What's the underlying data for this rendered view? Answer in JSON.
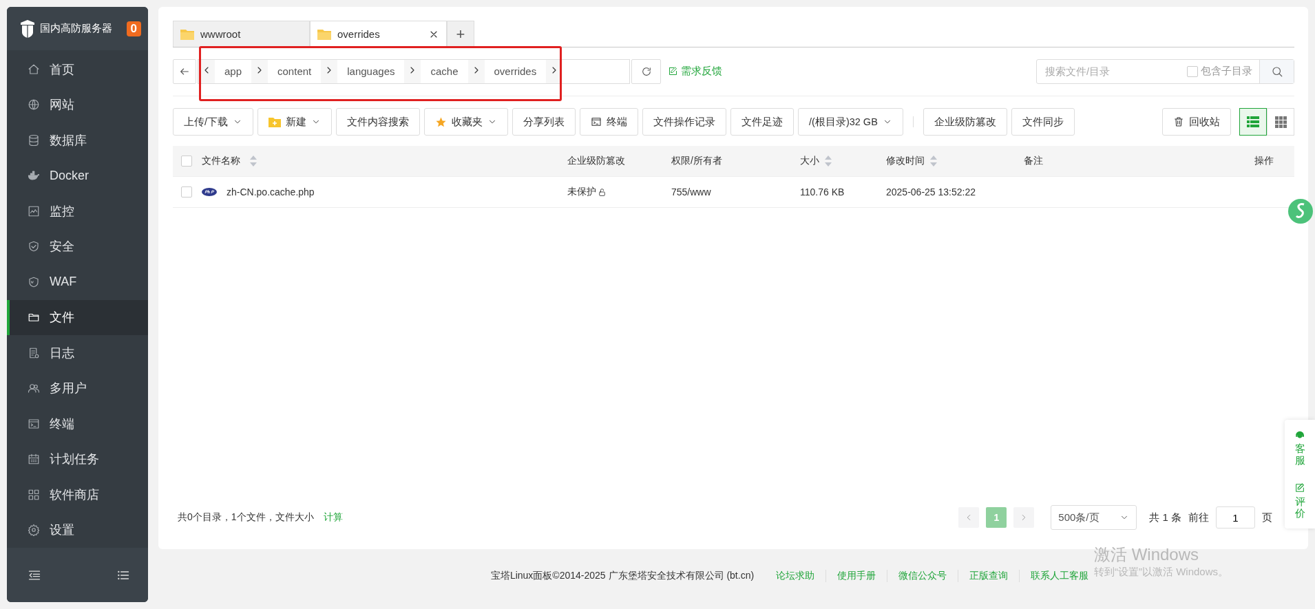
{
  "sidebar": {
    "brand": "国内高防服务器",
    "badge": "0",
    "items": [
      {
        "label": "首页",
        "selected": false
      },
      {
        "label": "网站",
        "selected": false
      },
      {
        "label": "数据库",
        "selected": false
      },
      {
        "label": "Docker",
        "selected": false
      },
      {
        "label": "监控",
        "selected": false
      },
      {
        "label": "安全",
        "selected": false
      },
      {
        "label": "WAF",
        "selected": false
      },
      {
        "label": "文件",
        "selected": true
      },
      {
        "label": "日志",
        "selected": false
      },
      {
        "label": "多用户",
        "selected": false
      },
      {
        "label": "终端",
        "selected": false
      },
      {
        "label": "计划任务",
        "selected": false
      },
      {
        "label": "软件商店",
        "selected": false
      },
      {
        "label": "设置",
        "selected": false
      }
    ]
  },
  "tabs": [
    {
      "label": "wwwroot",
      "selected": false,
      "closable": false
    },
    {
      "label": "overrides",
      "selected": true,
      "closable": true
    }
  ],
  "tab_add": "+",
  "breadcrumb": [
    "app",
    "content",
    "languages",
    "cache",
    "overrides"
  ],
  "feedback": "需求反馈",
  "search": {
    "placeholder": "搜索文件/目录",
    "include_sub": {
      "label": "包含子目录",
      "checked": false
    }
  },
  "toolbar": [
    {
      "label": "上传/下载",
      "dropdown": true
    },
    {
      "label": "新建",
      "dropdown": true
    },
    {
      "label": "文件内容搜索",
      "dropdown": false
    },
    {
      "label": "收藏夹",
      "dropdown": true
    },
    {
      "label": "分享列表",
      "dropdown": false
    },
    {
      "label": "终端",
      "dropdown": false
    },
    {
      "label": "文件操作记录",
      "dropdown": false
    },
    {
      "label": "文件足迹",
      "dropdown": false
    },
    {
      "label": "/(根目录)32 GB",
      "dropdown": true
    }
  ],
  "toolbar_extra": [
    {
      "label": "企业级防篡改"
    },
    {
      "label": "文件同步"
    }
  ],
  "recycle": "回收站",
  "view_modes": [
    {
      "kind": "list",
      "selected": true
    },
    {
      "kind": "grid",
      "selected": false
    }
  ],
  "table": {
    "all_checked": false,
    "columns": [
      {
        "label": "文件名称",
        "sortable": true
      },
      {
        "label": "企业级防篡改",
        "sortable": false
      },
      {
        "label": "权限/所有者",
        "sortable": false
      },
      {
        "label": "大小",
        "sortable": true
      },
      {
        "label": "修改时间",
        "sortable": true
      },
      {
        "label": "备注",
        "sortable": false
      },
      {
        "label": "操作",
        "sortable": false
      }
    ],
    "rows": [
      {
        "checked": false,
        "name": "zh-CN.po.cache.php",
        "protection": "未保护",
        "permission": "755/www",
        "size": "110.76 KB",
        "modified": "2025-06-25 13:52:22"
      }
    ]
  },
  "summary": "共0个目录，1个文件，文件大小",
  "summary_link": "计算",
  "pagination": {
    "pages": [
      {
        "label": "1",
        "selected": true
      }
    ],
    "page_size": "500条/页",
    "total": "共 1 条",
    "goto_label": "前往",
    "goto_value": "1",
    "page_suffix": "页"
  },
  "footer": {
    "copyright": "宝塔Linux面板©2014-2025 广东堡塔安全技术有限公司 (bt.cn)",
    "links": [
      "论坛求助",
      "使用手册",
      "微信公众号",
      "正版查询",
      "联系人工客服"
    ]
  },
  "float_panel": [
    {
      "label": "客服"
    },
    {
      "label": "评价"
    }
  ],
  "windows_notice": {
    "title": "激活 Windows",
    "text": "转到“设置”以激活 Windows。"
  }
}
